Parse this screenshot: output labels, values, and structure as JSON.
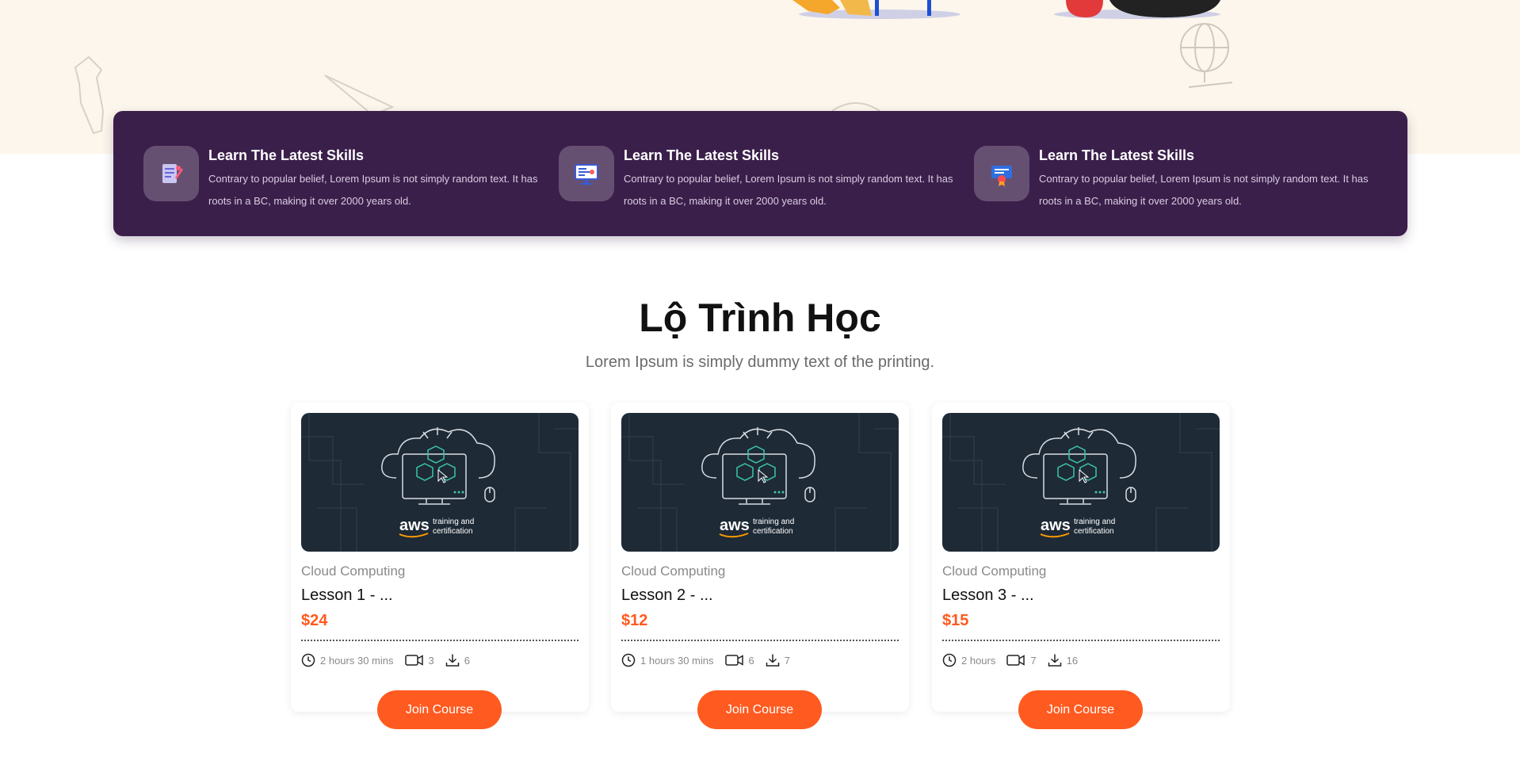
{
  "features": [
    {
      "icon": "document-pen-icon",
      "title": "Learn The Latest Skills",
      "desc": "Contrary to popular belief, Lorem Ipsum is not simply random text. It has roots in a BC, making it over 2000 years old."
    },
    {
      "icon": "presentation-board-icon",
      "title": "Learn The Latest Skills",
      "desc": "Contrary to popular belief, Lorem Ipsum is not simply random text. It has roots in a BC, making it over 2000 years old."
    },
    {
      "icon": "certificate-icon",
      "title": "Learn The Latest Skills",
      "desc": "Contrary to popular belief, Lorem Ipsum is not simply random text. It has roots in a BC, making it over 2000 years old."
    }
  ],
  "section": {
    "title": "Lộ Trình Học",
    "subtitle": "Lorem Ipsum is simply dummy text of the printing."
  },
  "courses": [
    {
      "category": "Cloud Computing",
      "title": "Lesson 1 - ...",
      "price": "$24",
      "duration": "2 hours 30 mins",
      "videos": "3",
      "downloads": "6",
      "button": "Join Course",
      "thumb_brand": "aws",
      "thumb_line1": "training and",
      "thumb_line2": "certification"
    },
    {
      "category": "Cloud Computing",
      "title": "Lesson 2 - ...",
      "price": "$12",
      "duration": "1 hours 30 mins",
      "videos": "6",
      "downloads": "7",
      "button": "Join Course",
      "thumb_brand": "aws",
      "thumb_line1": "training and",
      "thumb_line2": "certification"
    },
    {
      "category": "Cloud Computing",
      "title": "Lesson 3 - ...",
      "price": "$15",
      "duration": "2 hours",
      "videos": "7",
      "downloads": "16",
      "button": "Join Course",
      "thumb_brand": "aws",
      "thumb_line1": "training and",
      "thumb_line2": "certification"
    }
  ],
  "colors": {
    "accent": "#ff5a1f",
    "banner": "#3b1f4b",
    "hero": "#fcf6ec"
  }
}
